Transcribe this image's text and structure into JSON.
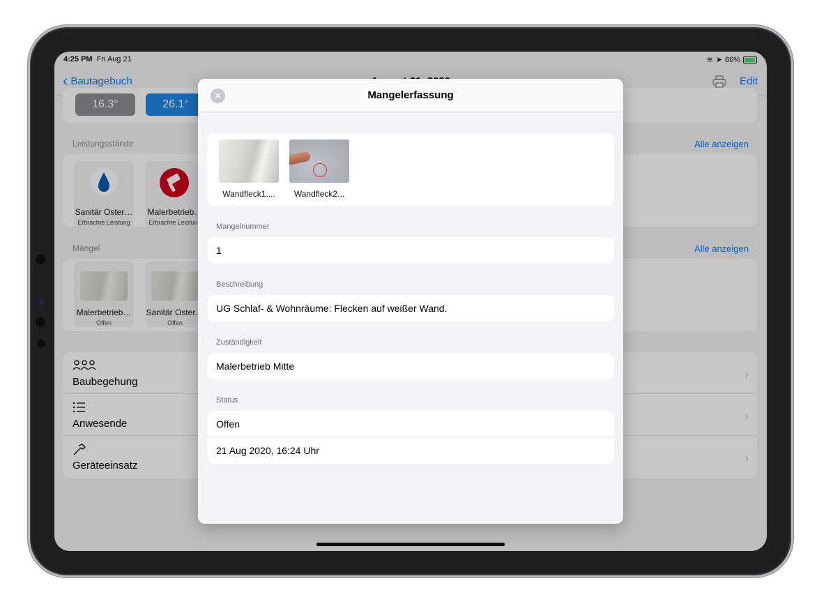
{
  "status_bar": {
    "time": "4:25 PM",
    "date": "Fri Aug 21",
    "battery": "86%"
  },
  "nav": {
    "back_label": "Bautagebuch",
    "title": "August 21, 2020",
    "edit_label": "Edit"
  },
  "weather": {
    "low": "16.3°",
    "high": "26.1°"
  },
  "leistung": {
    "label": "Leistungsstände",
    "all_label": "Alle anzeigen",
    "items": [
      {
        "name": "Sanitär Oster…",
        "sub": "Erbrachte Leistung"
      },
      {
        "name": "Malerbetrieb…",
        "sub": "Erbrachte Leistung"
      }
    ]
  },
  "maengel": {
    "label": "Mängel",
    "all_label": "Alle anzeigen",
    "items": [
      {
        "name": "Malerbetrieb…",
        "sub": "Offen"
      },
      {
        "name": "Sanitär Oster…",
        "sub": "Offen"
      }
    ]
  },
  "menu": [
    {
      "label": "Baubegehung",
      "icon": "people-icon"
    },
    {
      "label": "Anwesende",
      "icon": "list-icon"
    },
    {
      "label": "Geräteeinsatz",
      "icon": "hammer-icon"
    }
  ],
  "modal": {
    "title": "Mangelerfassung",
    "photos": [
      {
        "caption": "Wandfleck1...."
      },
      {
        "caption": "Wandfleck2..."
      }
    ],
    "mangelnummer_label": "Mangelnummer",
    "mangelnummer": "1",
    "beschreibung_label": "Beschreibung",
    "beschreibung": "UG Schlaf- & Wohnräume: Flecken auf weißer Wand.",
    "zustaendigkeit_label": "Zuständigkeit",
    "zustaendigkeit": "Malerbetrieb Mitte",
    "status_label": "Status",
    "status": "Offen",
    "datum": "21 Aug 2020, 16:24 Uhr"
  },
  "colors": {
    "accent": "#007aff",
    "paint_red": "#d0021b",
    "drop_blue": "#0a5bb0"
  }
}
